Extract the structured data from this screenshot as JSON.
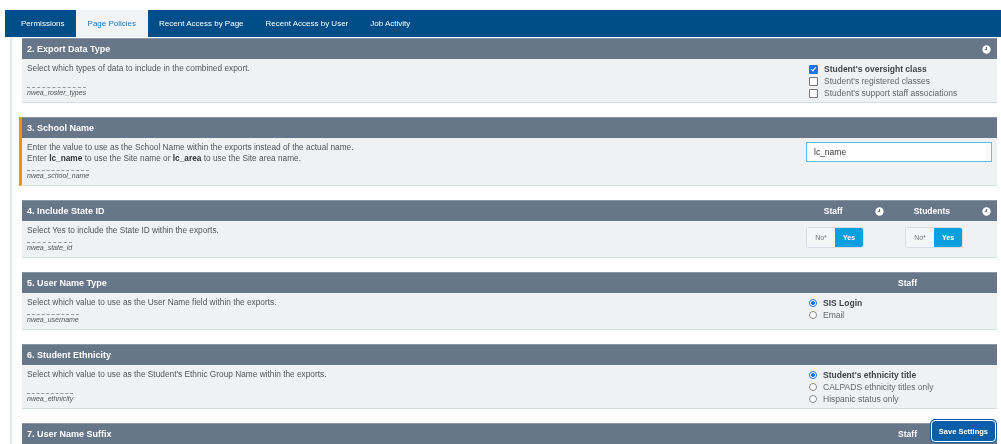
{
  "tabs": [
    {
      "label": "Permissions",
      "selected": false
    },
    {
      "label": "Page Policies",
      "selected": true
    },
    {
      "label": "Recent Access by Page",
      "selected": false
    },
    {
      "label": "Recent Access by User",
      "selected": false
    },
    {
      "label": "Job Activity",
      "selected": false
    }
  ],
  "sections": [
    {
      "title": "2. Export Data Type",
      "highlighted": false,
      "header_items": [
        {
          "kind": "clock"
        }
      ],
      "description": [
        "Select which types of data to include in the combined export."
      ],
      "key": "nwea_roster_types",
      "kind": "checkbox",
      "options": [
        {
          "label": "Student's oversight class",
          "checked": true
        },
        {
          "label": "Student's registered classes",
          "checked": false
        },
        {
          "label": "Student's support staff associations",
          "checked": false
        }
      ]
    },
    {
      "title": "3. School Name",
      "highlighted": true,
      "description": [
        "Enter the value to use as the School Name within the exports instead of the actual name.",
        "Enter **lc_name** to use the Site name or **lc_area** to use the Site area name."
      ],
      "key": "nwea_school_name",
      "kind": "text",
      "value": "lc_name"
    },
    {
      "title": "4. Include State ID",
      "highlighted": false,
      "header_items": [
        {
          "kind": "label",
          "text": "Staff"
        },
        {
          "kind": "clock"
        },
        {
          "kind": "label",
          "text": "Students"
        },
        {
          "kind": "clock"
        }
      ],
      "description": [
        "Select Yes to include the State ID within the exports."
      ],
      "key": "nwea_state_id",
      "kind": "toggle",
      "toggles": [
        {
          "options": [
            {
              "label": "No*",
              "selected": false
            },
            {
              "label": "Yes",
              "selected": true
            }
          ]
        },
        {
          "options": [
            {
              "label": "No*",
              "selected": false
            },
            {
              "label": "Yes",
              "selected": true
            }
          ]
        }
      ]
    },
    {
      "title": "5. User Name Type",
      "highlighted": false,
      "header_items": [
        {
          "kind": "label",
          "text": "Staff"
        }
      ],
      "description": [
        "Select which value to use as the User Name field within the exports."
      ],
      "key": "nwea_username",
      "kind": "radio",
      "options": [
        {
          "label": "SIS Login",
          "selected": true
        },
        {
          "label": "Email",
          "selected": false
        }
      ]
    },
    {
      "title": "6. Student Ethnicity",
      "highlighted": false,
      "description": [
        "Select which value to use as the Student's Ethnic Group Name within the exports."
      ],
      "key": "nwea_ethnicity",
      "kind": "radio",
      "options": [
        {
          "label": "Student's ethnicity title",
          "selected": true
        },
        {
          "label": "CALPADS ethnicity titles only",
          "selected": false
        },
        {
          "label": "Hispanic status only",
          "selected": false
        }
      ]
    },
    {
      "title": "7. User Name Suffix",
      "highlighted": false,
      "header_items": [
        {
          "kind": "label",
          "text": "Staff"
        }
      ],
      "kind": "none"
    }
  ],
  "save_button": "Save Settings"
}
